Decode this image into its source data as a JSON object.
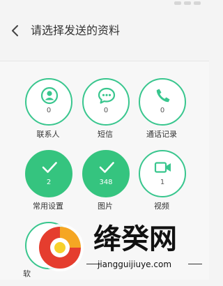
{
  "header": {
    "title": "请选择发送的资料",
    "back_icon": "chevron-left-icon"
  },
  "items": [
    {
      "label": "联系人",
      "count": "0",
      "icon": "person-icon",
      "selected": false
    },
    {
      "label": "短信",
      "count": "0",
      "icon": "chat-bubble-icon",
      "selected": false
    },
    {
      "label": "通话记录",
      "count": "0",
      "icon": "phone-icon",
      "selected": false
    },
    {
      "label": "常用设置",
      "count": "2",
      "icon": "check-icon",
      "selected": true
    },
    {
      "label": "图片",
      "count": "348",
      "icon": "check-icon",
      "selected": true
    },
    {
      "label": "视频",
      "count": "1",
      "icon": "video-camera-icon",
      "selected": false
    }
  ],
  "partial_item": {
    "label": "软"
  },
  "watermark": {
    "brand": "绛癸网",
    "url": "jiangguijiuye.com"
  },
  "colors": {
    "accent": "#35c47f",
    "outline": "#39c68e"
  }
}
